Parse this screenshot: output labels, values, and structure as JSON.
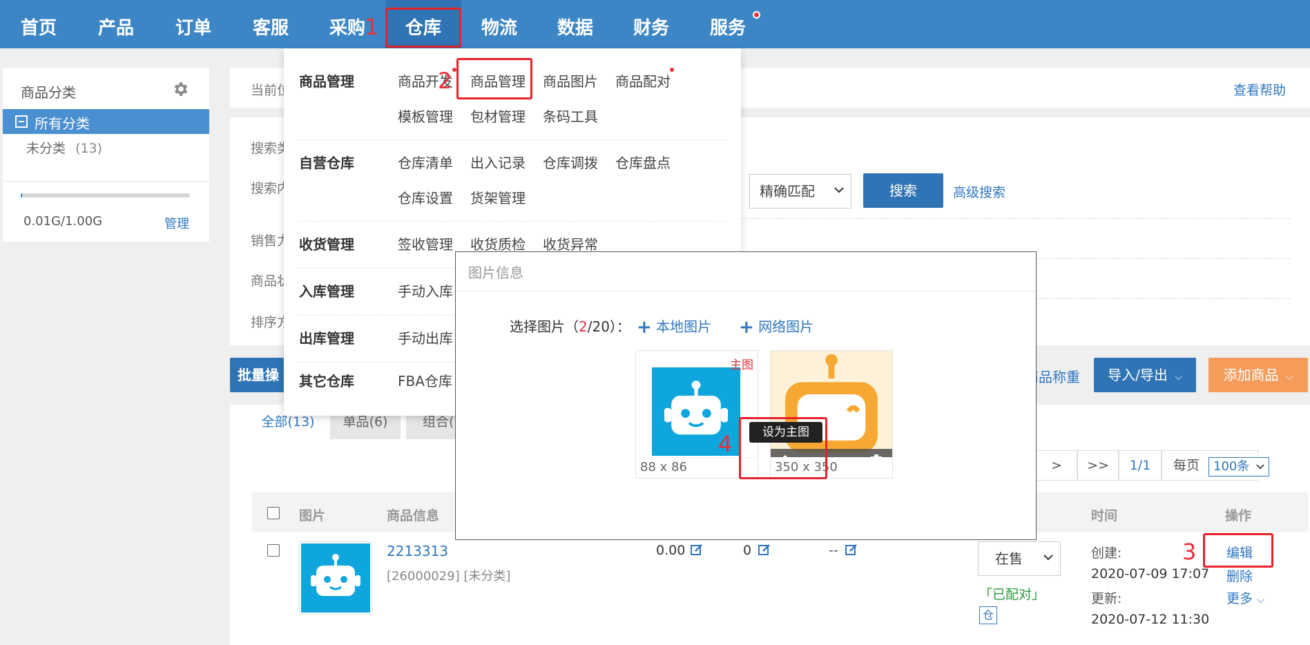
{
  "nav": {
    "items": [
      "首页",
      "产品",
      "订单",
      "客服",
      "采购",
      "仓库",
      "物流",
      "数据",
      "财务",
      "服务"
    ],
    "active": "仓库"
  },
  "annotations": [
    "1",
    "2",
    "3",
    "4"
  ],
  "sidebar": {
    "title": "商品分类",
    "all_label": "所有分类",
    "uncategorized": "未分类",
    "uncategorized_count": "(13)",
    "storage": "0.01G/1.00G",
    "manage": "管理",
    "storage_fraction": 0.01
  },
  "breadcrumb": {
    "prefix": "当前位",
    "help": "查看帮助"
  },
  "search": {
    "label_type": "搜索类",
    "label_content": "搜索内",
    "match_value": "精确匹配",
    "search_button": "搜索",
    "advanced": "高级搜索",
    "label_sales": "销售力",
    "label_goods": "商品状",
    "label_sort": "排序方"
  },
  "toolbar": {
    "batch": "批量操",
    "weight": "商品称重",
    "import_export": "导入/导出",
    "add_goods": "添加商品"
  },
  "tabs": [
    "全部(13)",
    "单品(6)",
    "组合("
  ],
  "pager": {
    "next": ">",
    "last": ">>",
    "page": "1/1",
    "per_page_label": "每页",
    "per_page_value": "100条"
  },
  "table": {
    "headers": {
      "image": "图片",
      "info": "商品信息",
      "time": "时间",
      "ops": "操作"
    },
    "row": {
      "sku": "2213313",
      "sub": "[26000029] [未分类]",
      "price": "0.00",
      "stock": "0",
      "extra": "--",
      "status": "在售",
      "paired": "「已配对」",
      "warehouse_tag": "仓",
      "created_label": "创建:",
      "created": "2020-07-09 17:07",
      "updated_label": "更新:",
      "updated": "2020-07-12 11:30",
      "edit": "编辑",
      "delete": "删除",
      "more": "更多"
    }
  },
  "menu": {
    "groups": [
      {
        "title": "商品管理",
        "items": [
          "商品开发",
          "商品管理",
          "商品图片",
          "商品配对",
          "模板管理",
          "包材管理",
          "条码工具"
        ]
      },
      {
        "title": "自营仓库",
        "items": [
          "仓库清单",
          "出入记录",
          "仓库调拨",
          "仓库盘点",
          "仓库设置",
          "货架管理"
        ]
      },
      {
        "title": "收货管理",
        "items": [
          "签收管理",
          "收货质检",
          "收货异常"
        ]
      },
      {
        "title": "入库管理",
        "items": [
          "手动入库"
        ]
      },
      {
        "title": "出库管理",
        "items": [
          "手动出库"
        ]
      },
      {
        "title": "其它仓库",
        "items": [
          "FBA仓库"
        ]
      }
    ]
  },
  "modal": {
    "title": "图片信息",
    "select_label": "选择图片（",
    "count_current": "2",
    "count_total": "/20）：",
    "local": "本地图片",
    "network": "网络图片",
    "main_tag": "主图",
    "thumb1_size": "88 x 86",
    "thumb2_size": "350 x 350",
    "tooltip": "设为主图"
  },
  "colors": {
    "nav": "#3d86c6",
    "accent": "#2f77c0",
    "orange": "#f59c5b",
    "robot_blue": "#0ea6dc",
    "robot_orange": "#f7a832",
    "annotation": "#e8303a"
  }
}
